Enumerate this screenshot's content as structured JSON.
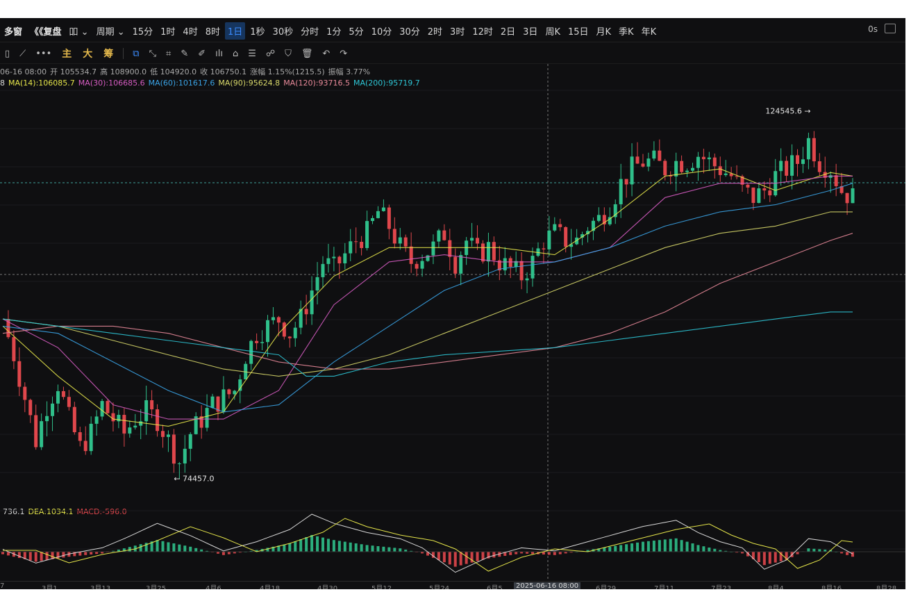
{
  "topbar": {
    "items": [
      "多窗",
      "《《复盘",
      "吅 ⌄",
      "周期 ⌄",
      "15分",
      "1时",
      "4时",
      "8时",
      "1日",
      "1秒",
      "30秒",
      "分时",
      "1分",
      "5分",
      "10分",
      "30分",
      "2时",
      "3时",
      "12时",
      "2日",
      "3日",
      "周K",
      "15日",
      "月K",
      "季K",
      "年K"
    ],
    "active_index": 8,
    "right_label": "0s"
  },
  "toolbar": {
    "before": [
      "▯",
      "⟋",
      "•••"
    ],
    "cn": [
      "主",
      "大",
      "筹"
    ],
    "icons": [
      "⧉",
      "⤡",
      "⌗",
      "✎",
      "✐",
      "ılı",
      "⌂",
      "☰",
      "☍",
      "⛉",
      "🗑",
      "↶",
      "↷"
    ]
  },
  "info1": [
    "06-16 08:00",
    "开 105534.7",
    "高 108900.0",
    "低 104920.0",
    "收 106750.1",
    "涨幅 1.15%(1215.5)",
    "振幅 3.77%"
  ],
  "info2": [
    {
      "text": "8",
      "color": "#d9d9d9"
    },
    {
      "text": "MA(14):106085.7",
      "color": "#e6e64a"
    },
    {
      "text": "MA(30):106685.6",
      "color": "#d65cc2"
    },
    {
      "text": "MA(60):101617.6",
      "color": "#3aa3e6"
    },
    {
      "text": "MA(90):95624.8",
      "color": "#d8d86a"
    },
    {
      "text": "MA(120):93716.5",
      "color": "#e98a9a"
    },
    {
      "text": "MA(200):95719.7",
      "color": "#2ec8d8"
    }
  ],
  "macd_info": [
    {
      "text": "736.1",
      "color": "#d9d9d9"
    },
    {
      "text": "DEA:1034.1",
      "color": "#e6e64a"
    },
    {
      "text": "MACD:-596.0",
      "color": "#e0474c"
    }
  ],
  "annotations": {
    "high": "124545.6 →",
    "low": "← 74457.0"
  },
  "colors": {
    "up": "#2fbf8a",
    "down": "#e0474c"
  },
  "chart_data": {
    "type": "candlestick",
    "x_labels": [
      "7",
      "3月1",
      "3月13",
      "3月25",
      "4月6",
      "4月18",
      "4月30",
      "5月12",
      "5月24",
      "6月5",
      "2025-06-16 08:00",
      "6月29",
      "7月11",
      "7月23",
      "8月4",
      "8月16",
      "8月28"
    ],
    "crosshair_label": "2025-06-16 08:00",
    "close_path": [
      [
        0,
        96000
      ],
      [
        2,
        91000
      ],
      [
        4,
        85000
      ],
      [
        6,
        79000
      ],
      [
        8,
        84000
      ],
      [
        10,
        87000
      ],
      [
        12,
        82000
      ],
      [
        14,
        78000
      ],
      [
        16,
        80000
      ],
      [
        18,
        84000
      ],
      [
        20,
        82000
      ],
      [
        22,
        80000
      ],
      [
        24,
        82000
      ],
      [
        26,
        83000
      ],
      [
        28,
        82000
      ],
      [
        30,
        79000
      ],
      [
        32,
        76000
      ],
      [
        34,
        80000
      ],
      [
        36,
        82000
      ],
      [
        38,
        84000
      ],
      [
        40,
        85000
      ],
      [
        42,
        86000
      ],
      [
        44,
        91000
      ],
      [
        46,
        94000
      ],
      [
        48,
        95000
      ],
      [
        50,
        96000
      ],
      [
        52,
        94000
      ],
      [
        54,
        96000
      ],
      [
        56,
        100000
      ],
      [
        58,
        104000
      ],
      [
        60,
        103000
      ],
      [
        62,
        105000
      ],
      [
        64,
        107000
      ],
      [
        66,
        108000
      ],
      [
        68,
        111000
      ],
      [
        70,
        109000
      ],
      [
        72,
        106000
      ],
      [
        74,
        104000
      ],
      [
        76,
        105000
      ],
      [
        78,
        106000
      ],
      [
        80,
        108000
      ],
      [
        82,
        104000
      ],
      [
        84,
        107000
      ],
      [
        86,
        105000
      ],
      [
        88,
        106000
      ],
      [
        90,
        104000
      ],
      [
        92,
        103000
      ],
      [
        94,
        102000
      ],
      [
        96,
        104000
      ],
      [
        98,
        107000
      ],
      [
        100,
        108000
      ],
      [
        102,
        107000
      ],
      [
        104,
        107000
      ],
      [
        106,
        109000
      ],
      [
        108,
        110000
      ],
      [
        110,
        112000
      ],
      [
        112,
        115000
      ],
      [
        114,
        117000
      ],
      [
        116,
        118000
      ],
      [
        118,
        118000
      ],
      [
        120,
        117000
      ],
      [
        122,
        118000
      ],
      [
        124,
        118000
      ],
      [
        126,
        119000
      ],
      [
        128,
        118000
      ],
      [
        130,
        117000
      ],
      [
        132,
        116000
      ],
      [
        134,
        114000
      ],
      [
        136,
        113000
      ],
      [
        138,
        114000
      ],
      [
        140,
        116000
      ],
      [
        142,
        117000
      ],
      [
        144,
        118000
      ],
      [
        146,
        121000
      ],
      [
        148,
        118000
      ],
      [
        150,
        117000
      ],
      [
        152,
        114000
      ],
      [
        154,
        113000
      ]
    ],
    "high": 124545.6,
    "low": 74457.0,
    "ma_series": [
      {
        "name": "MA(14)",
        "color": "#e6e64a",
        "values": [
          [
            0,
            95000
          ],
          [
            10,
            88000
          ],
          [
            20,
            82000
          ],
          [
            30,
            81000
          ],
          [
            40,
            83000
          ],
          [
            50,
            94000
          ],
          [
            60,
            102000
          ],
          [
            70,
            106000
          ],
          [
            80,
            106000
          ],
          [
            90,
            106000
          ],
          [
            100,
            105000
          ],
          [
            110,
            110000
          ],
          [
            120,
            116000
          ],
          [
            130,
            117000
          ],
          [
            140,
            114000
          ],
          [
            150,
            116500
          ],
          [
            154,
            116000
          ]
        ]
      },
      {
        "name": "MA(30)",
        "color": "#d65cc2",
        "values": [
          [
            0,
            96000
          ],
          [
            10,
            92000
          ],
          [
            20,
            84000
          ],
          [
            30,
            82000
          ],
          [
            40,
            82000
          ],
          [
            50,
            86000
          ],
          [
            60,
            98000
          ],
          [
            70,
            104000
          ],
          [
            80,
            105000
          ],
          [
            90,
            104000
          ],
          [
            100,
            104000
          ],
          [
            110,
            106000
          ],
          [
            120,
            113000
          ],
          [
            130,
            115000
          ],
          [
            140,
            115000
          ],
          [
            150,
            116000
          ],
          [
            154,
            116000
          ]
        ]
      },
      {
        "name": "MA(60)",
        "color": "#3aa3e6",
        "values": [
          [
            0,
            95000
          ],
          [
            10,
            94000
          ],
          [
            20,
            90000
          ],
          [
            30,
            86000
          ],
          [
            40,
            83000
          ],
          [
            50,
            84000
          ],
          [
            60,
            90000
          ],
          [
            70,
            95000
          ],
          [
            80,
            100000
          ],
          [
            90,
            103000
          ],
          [
            100,
            104000
          ],
          [
            110,
            106000
          ],
          [
            120,
            109000
          ],
          [
            130,
            111000
          ],
          [
            140,
            112000
          ],
          [
            150,
            114000
          ],
          [
            154,
            115000
          ]
        ]
      },
      {
        "name": "MA(90)",
        "color": "#d8d86a",
        "values": [
          [
            0,
            96000
          ],
          [
            10,
            95000
          ],
          [
            20,
            93000
          ],
          [
            30,
            91000
          ],
          [
            40,
            89000
          ],
          [
            50,
            88000
          ],
          [
            60,
            89000
          ],
          [
            70,
            91000
          ],
          [
            80,
            94000
          ],
          [
            90,
            97000
          ],
          [
            100,
            100000
          ],
          [
            110,
            103000
          ],
          [
            120,
            106000
          ],
          [
            130,
            108000
          ],
          [
            140,
            109000
          ],
          [
            150,
            111000
          ],
          [
            154,
            111000
          ]
        ]
      },
      {
        "name": "MA(120)",
        "color": "#e98a9a",
        "values": [
          [
            0,
            94000
          ],
          [
            10,
            95000
          ],
          [
            20,
            95000
          ],
          [
            30,
            94000
          ],
          [
            40,
            92000
          ],
          [
            50,
            90000
          ],
          [
            60,
            89000
          ],
          [
            70,
            89000
          ],
          [
            80,
            90000
          ],
          [
            90,
            91000
          ],
          [
            100,
            92000
          ],
          [
            110,
            94000
          ],
          [
            120,
            97000
          ],
          [
            130,
            101000
          ],
          [
            140,
            104000
          ],
          [
            150,
            107000
          ],
          [
            154,
            108000
          ]
        ]
      },
      {
        "name": "MA(200)",
        "color": "#2ec8d8",
        "values": [
          [
            0,
            96000
          ],
          [
            10,
            95000
          ],
          [
            20,
            94000
          ],
          [
            30,
            93000
          ],
          [
            40,
            92000
          ],
          [
            50,
            91000
          ],
          [
            55,
            88000
          ],
          [
            60,
            88000
          ],
          [
            70,
            90000
          ],
          [
            80,
            91000
          ],
          [
            90,
            91500
          ],
          [
            100,
            92000
          ],
          [
            110,
            93000
          ],
          [
            120,
            94000
          ],
          [
            130,
            95000
          ],
          [
            140,
            96000
          ],
          [
            150,
            97000
          ],
          [
            154,
            97000
          ]
        ]
      }
    ],
    "macd": [
      [
        0,
        -300
      ],
      [
        6,
        -1200
      ],
      [
        12,
        -600
      ],
      [
        18,
        -200
      ],
      [
        22,
        400
      ],
      [
        28,
        1400
      ],
      [
        34,
        600
      ],
      [
        40,
        -400
      ],
      [
        46,
        200
      ],
      [
        52,
        1000
      ],
      [
        56,
        2000
      ],
      [
        60,
        1400
      ],
      [
        66,
        800
      ],
      [
        72,
        400
      ],
      [
        76,
        -200
      ],
      [
        82,
        -1800
      ],
      [
        88,
        -800
      ],
      [
        94,
        -200
      ],
      [
        100,
        -400
      ],
      [
        106,
        200
      ],
      [
        110,
        600
      ],
      [
        116,
        1200
      ],
      [
        122,
        1600
      ],
      [
        126,
        800
      ],
      [
        130,
        200
      ],
      [
        134,
        -200
      ],
      [
        138,
        -1600
      ],
      [
        142,
        -1000
      ],
      [
        146,
        400
      ],
      [
        150,
        200
      ],
      [
        154,
        -600
      ]
    ],
    "ylim": [
      72000,
      128000
    ]
  }
}
